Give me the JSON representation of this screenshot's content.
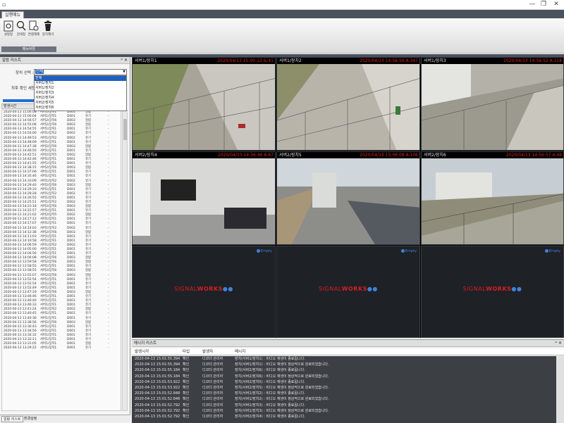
{
  "window": {
    "app_icon": "▫",
    "minimize": "—",
    "maximize": "❐",
    "close": "✕"
  },
  "ribbon": {
    "tab": "실행메뉴",
    "tools": [
      {
        "label": "설정창",
        "icon": "settings-window-icon"
      },
      {
        "label": "검색창",
        "icon": "search-icon"
      },
      {
        "label": "연결해제",
        "icon": "disconnect-icon"
      },
      {
        "label": "장치제거",
        "icon": "trash-icon"
      }
    ],
    "group_label": "메뉴버튼"
  },
  "alarm_panel": {
    "title": "알람 리스트",
    "pin": "ᵖ ✕",
    "device_select_label": "장치 선택 :",
    "device_selected": "전체",
    "device_options": [
      "전체",
      "서버1/장치1",
      "서버1/장치2",
      "서버1/장치3",
      "서버2/장치4",
      "서버2/장치5",
      "서버2/장치6"
    ],
    "confirm_label": "최후 확인 세팅",
    "list_header": "발생시간",
    "rows": [
      [
        "2020-04-13 15:00:08",
        "서버1/장치1",
        "D001",
        "알람",
        "-"
      ],
      [
        "2020-04-13 15:00:04",
        "서버1/장치1",
        "D001",
        "유기",
        "-"
      ],
      [
        "2020-04-13 14:56:57",
        "서버2/장치6",
        "D003",
        "알람",
        "-"
      ],
      [
        "2020-04-13 14:55:08",
        "서버2/장치6",
        "D003",
        "알람",
        "-"
      ],
      [
        "2020-04-13 14:54:55",
        "서버1/장치1",
        "D001",
        "유기",
        "-"
      ],
      [
        "2020-04-13 14:54:00",
        "서버1/장치2",
        "D002",
        "유기",
        "-"
      ],
      [
        "2020-04-13 14:49:53",
        "서버1/장치2",
        "D002",
        "유기",
        "-"
      ],
      [
        "2020-04-13 14:48:09",
        "서버1/장치1",
        "D001",
        "유기",
        "-"
      ],
      [
        "2020-04-13 14:47:38",
        "서버2/장치6",
        "D003",
        "알람",
        "-"
      ],
      [
        "2020-04-13 14:46:50",
        "서버1/장치1",
        "D001",
        "유기",
        "-"
      ],
      [
        "2020-04-13 14:42:51",
        "서버2/장치5",
        "D002",
        "알람",
        "-"
      ],
      [
        "2020-04-13 14:42:46",
        "서버1/장치1",
        "D001",
        "유기",
        "-"
      ],
      [
        "2020-04-13 14:41:55",
        "서버1/장치1",
        "D001",
        "유기",
        "-"
      ],
      [
        "2020-04-13 14:38:15",
        "서버2/장치6",
        "D003",
        "알람",
        "-"
      ],
      [
        "2020-04-13 14:37:06",
        "서버1/장치1",
        "D001",
        "유기",
        "-"
      ],
      [
        "2020-04-13 14:35:46",
        "서버1/장치1",
        "D001",
        "유기",
        "-"
      ],
      [
        "2020-04-13 14:33:09",
        "서버1/장치2",
        "D002",
        "유기",
        "-"
      ],
      [
        "2020-04-13 14:29:40",
        "서버2/장치6",
        "D003",
        "알람",
        "-"
      ],
      [
        "2020-04-13 14:29:33",
        "서버1/장치1",
        "D001",
        "유기",
        "-"
      ],
      [
        "2020-04-13 14:28:28",
        "서버1/장치2",
        "D002",
        "유기",
        "-"
      ],
      [
        "2020-04-13 14:26:55",
        "서버1/장치1",
        "D001",
        "유기",
        "-"
      ],
      [
        "2020-04-13 14:25:51",
        "서버1/장치2",
        "D002",
        "유기",
        "-"
      ],
      [
        "2020-04-13 14:23:18",
        "서버2/장치6",
        "D003",
        "알람",
        "-"
      ],
      [
        "2020-04-13 14:22:57",
        "서버1/장치1",
        "D001",
        "유기",
        "-"
      ],
      [
        "2020-04-13 14:21:02",
        "서버2/장치5",
        "D002",
        "알람",
        "-"
      ],
      [
        "2020-04-13 14:17:12",
        "서버1/장치1",
        "D001",
        "유기",
        "-"
      ],
      [
        "2020-04-13 14:17:07",
        "서버1/장치1",
        "D001",
        "유기",
        "-"
      ],
      [
        "2020-04-13 14:14:03",
        "서버1/장치2",
        "D002",
        "유기",
        "-"
      ],
      [
        "2020-04-13 14:12:38",
        "서버2/장치6",
        "D003",
        "알람",
        "-"
      ],
      [
        "2020-04-13 14:11:03",
        "서버1/장치1",
        "D001",
        "유기",
        "-"
      ],
      [
        "2020-04-13 14:10:58",
        "서버1/장치1",
        "D001",
        "유기",
        "-"
      ],
      [
        "2020-04-13 14:06:59",
        "서버1/장치2",
        "D002",
        "유기",
        "-"
      ],
      [
        "2020-04-13 14:05:00",
        "서버1/장치1",
        "D001",
        "유기",
        "-"
      ],
      [
        "2020-04-13 14:04:56",
        "서버1/장치1",
        "D001",
        "유기",
        "-"
      ],
      [
        "2020-04-13 14:04:08",
        "서버2/장치6",
        "D003",
        "알람",
        "-"
      ],
      [
        "2020-04-13 13:59:58",
        "서버2/장치6",
        "D003",
        "알람",
        "-"
      ],
      [
        "2020-04-13 13:58:55",
        "서버1/장치1",
        "D001",
        "유기",
        "-"
      ],
      [
        "2020-04-13 13:58:55",
        "서버2/장치6",
        "D003",
        "알람",
        "-"
      ],
      [
        "2020-04-13 13:55:07",
        "서버2/장치6",
        "D003",
        "알람",
        "-"
      ],
      [
        "2020-04-13 13:52:54",
        "서버1/장치1",
        "D001",
        "유기",
        "-"
      ],
      [
        "2020-04-13 13:52:54",
        "서버1/장치1",
        "D001",
        "유기",
        "-"
      ],
      [
        "2020-04-13 13:52:49",
        "서버1/장치1",
        "D001",
        "유기",
        "-"
      ],
      [
        "2020-04-13 13:47:19",
        "서버2/장치6",
        "D003",
        "알람",
        "-"
      ],
      [
        "2020-04-13 13:46:46",
        "서버1/장치1",
        "D001",
        "유기",
        "-"
      ],
      [
        "2020-04-13 13:46:40",
        "서버1/장치1",
        "D001",
        "유기",
        "-"
      ],
      [
        "2020-04-13 13:46:33",
        "서버1/장치1",
        "D001",
        "유기",
        "-"
      ],
      [
        "2020-04-13 13:41:24",
        "서버1/장치2",
        "D002",
        "알람",
        "-"
      ],
      [
        "2020-04-13 13:40:45",
        "서버1/장치1",
        "D001",
        "유기",
        "-"
      ],
      [
        "2020-04-13 13:40:36",
        "서버1/장치1",
        "D001",
        "유기",
        "-"
      ],
      [
        "2020-04-13 13:38:56",
        "서버2/장치6",
        "D003",
        "알람",
        "-"
      ],
      [
        "2020-04-13 13:36:43",
        "서버1/장치1",
        "D001",
        "유기",
        "-"
      ],
      [
        "2020-04-13 13:34:56",
        "서버1/장치1",
        "D001",
        "유기",
        "-"
      ],
      [
        "2020-04-13 13:34:32",
        "서버1/장치1",
        "D001",
        "유기",
        "-"
      ],
      [
        "2020-04-13 13:32:11",
        "서버1/장치1",
        "D001",
        "유기",
        "-"
      ],
      [
        "2020-04-13 13:31:05",
        "서버1/장치1",
        "D001",
        "알람",
        "-"
      ],
      [
        "2020-04-13 13:29:22",
        "서버1/장치1",
        "D001",
        "유기",
        "-"
      ]
    ],
    "bottom_tabs": [
      "알람 리스트",
      "환경설정"
    ]
  },
  "cameras": [
    {
      "name": "서버1/장치1",
      "timestamp": "2020/04/13 15:00:12 &:41"
    },
    {
      "name": "서버1/장치2",
      "timestamp": "2020/04/13 14:56:56 A:347"
    },
    {
      "name": "서버1/장치3",
      "timestamp": "2020/04/13 14:56:52 A:118"
    },
    {
      "name": "서버2/장치4",
      "timestamp": "2020/04/13 14:36:46 A:67"
    },
    {
      "name": "서버2/장치5",
      "timestamp": "2020/04/13 15:06:08 A:106"
    },
    {
      "name": "서버2/장치6",
      "timestamp": "2020/04/13 14:56:57 A:48"
    }
  ],
  "empty_slot": {
    "badge": "Empty",
    "logo_a": "SIGNAL",
    "logo_b": "WORKS",
    "logo_c": "●●"
  },
  "message_panel": {
    "title": "메시지 리스트",
    "pin": "ᵖ ✕",
    "columns": [
      "발생시각",
      "타입",
      "발생자",
      "메시지"
    ],
    "rows": [
      [
        "2020-04-13 15:01:55.394",
        "확인",
        "디코더 관리자",
        "장치(서버1/장치1) : 비디오 재생이 종료됩니다."
      ],
      [
        "2020-04-13 15:01:55.394",
        "확인",
        "디코더 관리자",
        "장치(서버1/장치1) : 비디오 재생이 정상적으로 완료되었습니다."
      ],
      [
        "2020-04-13 15:01:55.184",
        "확인",
        "디코더 관리자",
        "장치(서버2/장치6) : 비디오 재생이 종료됩니다."
      ],
      [
        "2020-04-13 15:01:55.184",
        "확인",
        "디코더 관리자",
        "장치(서버2/장치6) : 비디오 재생이 정상적으로 완료되었습니다."
      ],
      [
        "2020-04-13 15:01:53.922",
        "확인",
        "디코더 관리자",
        "장치(서버2/장치5) : 비디오 재생이 종료됩니다."
      ],
      [
        "2020-04-13 15:01:53.922",
        "확인",
        "디코더 관리자",
        "장치(서버2/장치5) : 비디오 재생이 정상적으로 완료되었습니다."
      ],
      [
        "2020-04-13 15:01:52.848",
        "확인",
        "디코더 관리자",
        "장치(서버1/장치2) : 비디오 재생이 종료됩니다."
      ],
      [
        "2020-04-13 15:01:52.848",
        "확인",
        "디코더 관리자",
        "장치(서버1/장치2) : 비디오 재생이 정상적으로 완료되었습니다."
      ],
      [
        "2020-04-13 15:01:52.792",
        "확인",
        "디코더 관리자",
        "장치(서버1/장치3) : 비디오 재생이 종료됩니다."
      ],
      [
        "2020-04-13 15:01:52.792",
        "확인",
        "디코더 관리자",
        "장치(서버1/장치3) : 비디오 재생이 정상적으로 완료되었습니다."
      ],
      [
        "2020-04-13 15:01:52.792",
        "확인",
        "디코더 관리자",
        "장치(서버2/장치4) : 비디오 재생이 종료됩니다."
      ]
    ]
  },
  "colors": {
    "alarm_timestamp": "#e02020",
    "accent": "#1f5fbf",
    "empty_badge": "#3f82d8"
  }
}
